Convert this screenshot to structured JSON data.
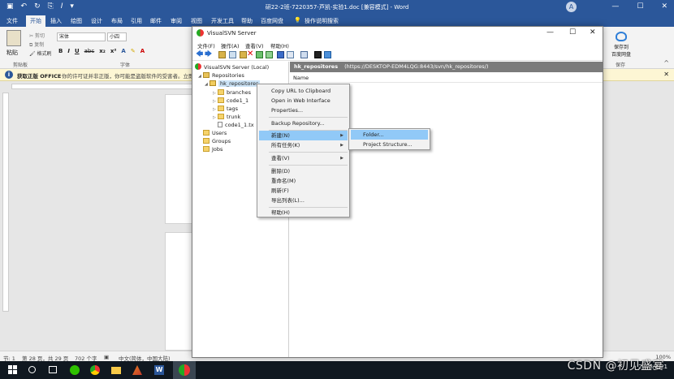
{
  "word": {
    "title": "研22-2班-7220357-芦凯-实验1.doc [兼容模式] - Word",
    "account_initial": "A",
    "window_buttons": [
      "—",
      "☐",
      "✕"
    ],
    "tabs": [
      "文件",
      "开始",
      "插入",
      "绘图",
      "设计",
      "布局",
      "引用",
      "邮件",
      "审阅",
      "视图",
      "开发工具",
      "帮助",
      "百度网盘",
      "操作说明搜索"
    ],
    "active_tab_index": 1,
    "ribbon": {
      "paste": "粘贴",
      "cut": "剪切",
      "copy": "复制",
      "format_painter": "格式刷",
      "font_name": "宋体",
      "font_size": "小四",
      "format_buttons": [
        "B",
        "I",
        "U",
        "abc",
        "x₂",
        "x²",
        "A"
      ],
      "group_clipboard": "剪贴板",
      "group_font": "字体",
      "save_to_baidu": "保存到\n百度网盘",
      "group_save": "保存"
    },
    "notice": {
      "bold": "获取正版 OFFICE",
      "text": "你的许可证并非正版，你可能是盗版软件的受害者。立即"
    },
    "status": {
      "section": "节: 1",
      "page": "第 28 页，共 29 页",
      "words": "702 个字",
      "language": "中文(简体，中国大陆)",
      "zoom": "100%"
    }
  },
  "svn": {
    "title": "VisualSVN Server",
    "window_buttons": [
      "—",
      "☐",
      "✕"
    ],
    "menus": [
      "文件(F)",
      "操作(A)",
      "查看(V)",
      "帮助(H)"
    ],
    "tree": {
      "server": "VisualSVN Server (Local)",
      "repositories": "Repositories",
      "repo": "hk_repositores",
      "children": [
        "branches",
        "code1_1",
        "tags",
        "trunk"
      ],
      "file": "code1_1.tx",
      "users": "Users",
      "groups": "Groups",
      "jobs": "Jobs"
    },
    "header": {
      "name": "hk_repositores",
      "url": "(https://DESKTOP-EDM4LQG:8443/svn/hk_repositores/)"
    },
    "column_name": "Name",
    "context_menu": {
      "copy_url": "Copy URL to Clipboard",
      "open_web": "Open in Web Interface",
      "properties": "Properties...",
      "backup": "Backup Repository...",
      "new": "新建(N)",
      "all_tasks": "所有任务(K)",
      "view": "查看(V)",
      "delete": "删除(D)",
      "rename": "重命名(M)",
      "refresh": "刷新(F)",
      "export_list": "导出列表(L)...",
      "help": "帮助(H)"
    },
    "submenu": {
      "folder": "Folder...",
      "project_structure": "Project Structure..."
    }
  },
  "taskbar": {
    "word_letter": "W",
    "tray_time": "",
    "tray_date": "2023/3/21"
  },
  "watermark": "CSDN @初见盛宴"
}
